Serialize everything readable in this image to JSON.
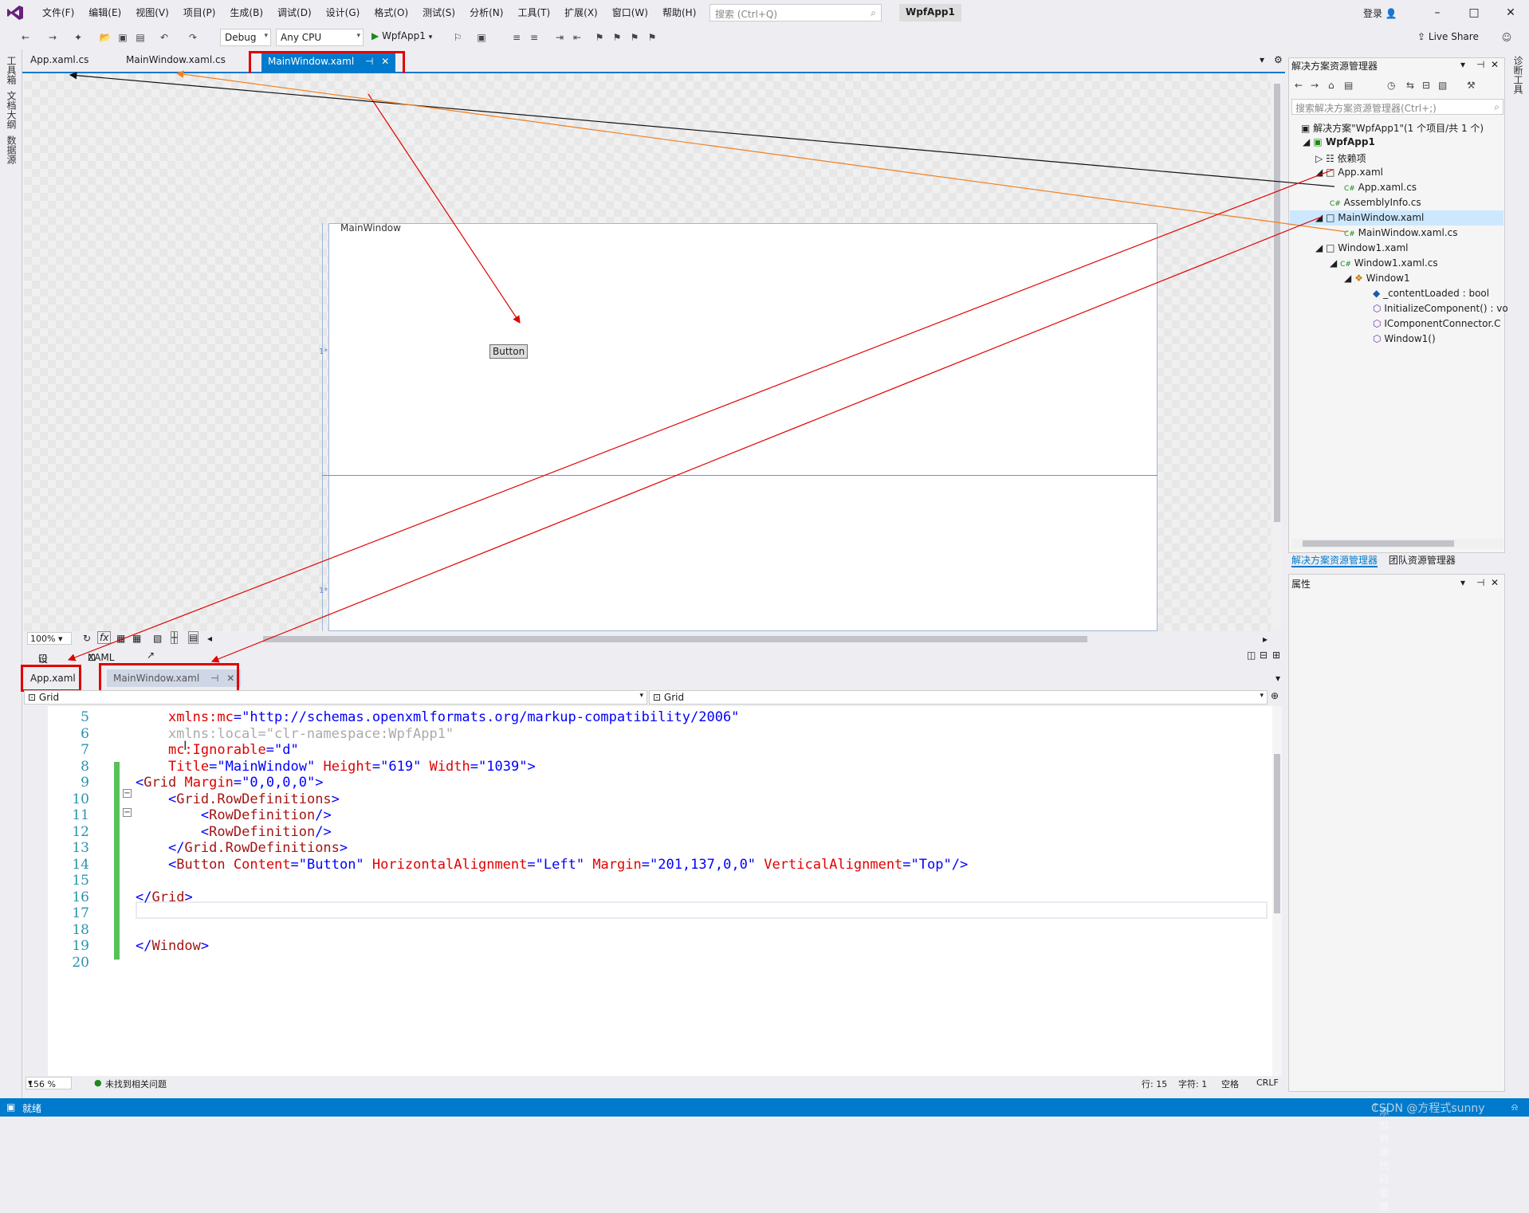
{
  "menubar": {
    "items": [
      "文件(F)",
      "编辑(E)",
      "视图(V)",
      "项目(P)",
      "生成(B)",
      "调试(D)",
      "设计(G)",
      "格式(O)",
      "测试(S)",
      "分析(N)",
      "工具(T)",
      "扩展(X)",
      "窗口(W)",
      "帮助(H)"
    ],
    "search_placeholder": "搜索 (Ctrl+Q)",
    "project_name": "WpfApp1",
    "login": "登录"
  },
  "toolbar": {
    "config": "Debug",
    "platform": "Any CPU",
    "run_label": "WpfApp1",
    "live_share": "Live Share"
  },
  "left_strip": [
    "工具箱",
    "文档大纲",
    "数据源"
  ],
  "right_strip": [
    "诊断工具"
  ],
  "doc_tabs": [
    "App.xaml.cs",
    "MainWindow.xaml.cs",
    "MainWindow.xaml"
  ],
  "designer": {
    "window_title": "MainWindow",
    "button_label": "Button",
    "zoom": "100%",
    "guide_marker_1": "1*",
    "guide_marker_2": "1*"
  },
  "split_tabs": {
    "design": "设计",
    "xaml": "XAML"
  },
  "bottom_tabs": [
    "App.xaml",
    "MainWindow.xaml"
  ],
  "nav_left": "Grid",
  "nav_right": "Grid",
  "code_lines": [
    {
      "n": "5",
      "text": "    xmlns:mc=\"http://schemas.openxmlformats.org/markup-compatibility/2006\""
    },
    {
      "n": "6",
      "text": "    xmlns:local=\"clr-namespace:WpfApp1\""
    },
    {
      "n": "7",
      "text": "    mc:Ignorable=\"d\""
    },
    {
      "n": "8",
      "text": "    Title=\"MainWindow\" Height=\"619\" Width=\"1039\">"
    },
    {
      "n": "9",
      "text": "<Grid Margin=\"0,0,0,0\">"
    },
    {
      "n": "10",
      "text": "    <Grid.RowDefinitions>"
    },
    {
      "n": "11",
      "text": "        <RowDefinition/>"
    },
    {
      "n": "12",
      "text": "        <RowDefinition/>"
    },
    {
      "n": "13",
      "text": "    </Grid.RowDefinitions>"
    },
    {
      "n": "14",
      "text": "    <Button Content=\"Button\" HorizontalAlignment=\"Left\" Margin=\"201,137,0,0\" VerticalAlignment=\"Top\"/>"
    },
    {
      "n": "15",
      "text": ""
    },
    {
      "n": "16",
      "text": "</Grid>"
    },
    {
      "n": "17",
      "text": ""
    },
    {
      "n": "18",
      "text": ""
    },
    {
      "n": "19",
      "text": "</Window>"
    },
    {
      "n": "20",
      "text": ""
    }
  ],
  "editor_status": {
    "zoom": "156 %",
    "issues": "未找到相关问题",
    "row": "行: 15",
    "col": "字符: 1",
    "spaces": "空格",
    "eol": "CRLF"
  },
  "statusbar": {
    "ready": "就绪",
    "source_control": "添加到源代码管理",
    "watermark": "CSDN @方程式sunny"
  },
  "solution_explorer": {
    "title": "解决方案资源管理器",
    "search_placeholder": "搜索解决方案资源管理器(Ctrl+;)",
    "items": [
      {
        "label": "解决方案\"WpfApp1\"(1 个项目/共 1 个)"
      },
      {
        "label": "WpfApp1"
      },
      {
        "label": "依赖项"
      },
      {
        "label": "App.xaml"
      },
      {
        "label": "App.xaml.cs"
      },
      {
        "label": "AssemblyInfo.cs"
      },
      {
        "label": "MainWindow.xaml"
      },
      {
        "label": "MainWindow.xaml.cs"
      },
      {
        "label": "Window1.xaml"
      },
      {
        "label": "Window1.xaml.cs"
      },
      {
        "label": "Window1"
      },
      {
        "label": "_contentLoaded : bool"
      },
      {
        "label": "InitializeComponent() : vo"
      },
      {
        "label": "IComponentConnector.C"
      },
      {
        "label": "Window1()"
      }
    ],
    "tab_solution": "解决方案资源管理器",
    "tab_team": "团队资源管理器"
  },
  "properties": {
    "title": "属性"
  },
  "colors": {
    "accent": "#007acc",
    "annotation_red": "#e00000",
    "annotation_orange": "#f08020"
  }
}
